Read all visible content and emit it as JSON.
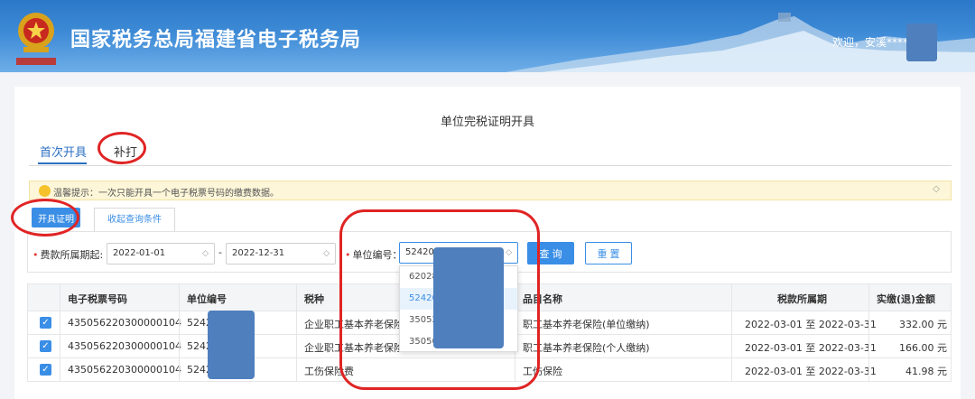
{
  "header": {
    "title": "国家税务总局福建省电子税务局",
    "welcome": "欢迎，安溪****"
  },
  "page": {
    "title": "单位完税证明开具",
    "tabs": [
      {
        "label": "首次开具",
        "active": true
      },
      {
        "label": "补打",
        "active": false
      }
    ],
    "notice": "温馨提示：一次只能开具一个电子税票号码的缴费数据。",
    "issue_button": "开具证明",
    "collapse_tab": "收起查询条件"
  },
  "filter": {
    "period_label": "费款所属期起:",
    "start_date": "2022-01-01",
    "end_date": "2022-12-31",
    "date_separator": "-",
    "unit_label": "单位编号：",
    "unit_value": "524200",
    "query_button": "查 询",
    "reset_button": "重 置",
    "dropdown_options": [
      {
        "label": "62028",
        "selected": false
      },
      {
        "label": "52420",
        "selected": true
      },
      {
        "label": "35052",
        "selected": false
      },
      {
        "label": "35050",
        "selected": false
      }
    ]
  },
  "table": {
    "headers": [
      "电子税票号码",
      "单位编号",
      "税种",
      "品目名称",
      "税款所属期",
      "实缴(退)金额"
    ],
    "rows": [
      {
        "ticket": "435056220300000104",
        "unit": "5242",
        "tax": "企业职工基本养老保险",
        "item": "职工基本养老保险(单位缴纳)",
        "period": "2022-03-01 至 2022-03-31",
        "amount": "332.00 元",
        "checked": true
      },
      {
        "ticket": "435056220300000104",
        "unit": "5242",
        "tax": "企业职工基本养老保险",
        "item": "职工基本养老保险(个人缴纳)",
        "period": "2022-03-01 至 2022-03-31",
        "amount": "166.00 元",
        "checked": true
      },
      {
        "ticket": "435056220300000104",
        "unit": "5242",
        "tax": "工伤保险费",
        "item": "工伤保险",
        "period": "2022-03-01 至 2022-03-31",
        "amount": "41.98 元",
        "checked": true
      }
    ]
  },
  "icons": {
    "emblem": "tax-emblem-icon",
    "bulb": "lightbulb-icon",
    "calendar": "calendar-icon",
    "caret": "caret-icon",
    "checkbox": "checkbox-checked-icon"
  },
  "colors": {
    "primary": "#3a8ee6",
    "header": "#2c78c8",
    "annotation": "#e02424"
  }
}
